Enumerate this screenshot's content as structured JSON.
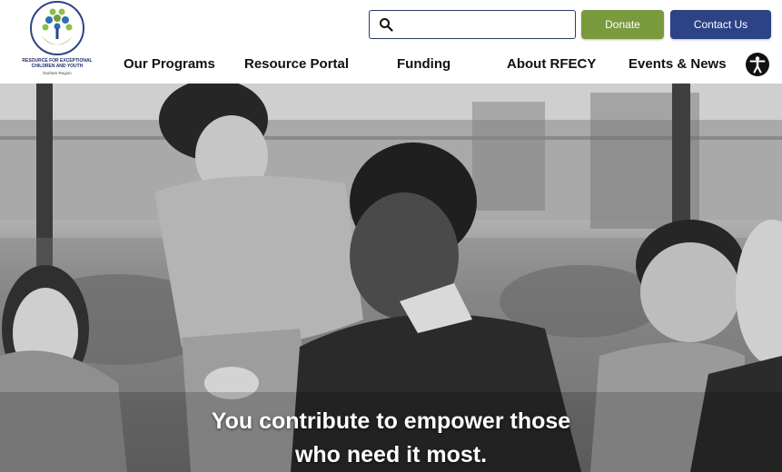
{
  "header": {
    "logo": {
      "org_name": "RESOURCE FOR EXCEPTIONAL CHILDREN AND YOUTH",
      "region": "Durham Region",
      "icon": "tree-hands-logo"
    },
    "search": {
      "placeholder": "",
      "value": "",
      "icon": "search-icon"
    },
    "donate_label": "Donate",
    "contact_label": "Contact Us",
    "colors": {
      "donate": "#7a9a3e",
      "contact": "#2c4386",
      "nav_text": "#111111"
    },
    "nav": [
      {
        "label": "Our Programs"
      },
      {
        "label": "Resource Portal"
      },
      {
        "label": "Funding"
      },
      {
        "label": "About RFECY"
      },
      {
        "label": "Events & News"
      }
    ],
    "accessibility_icon": "accessibility-icon"
  },
  "hero": {
    "image": "black-and-white photo of smiling youth and caregiver",
    "caption_line1": "You contribute to empower those",
    "caption_line2": "who need it most."
  }
}
